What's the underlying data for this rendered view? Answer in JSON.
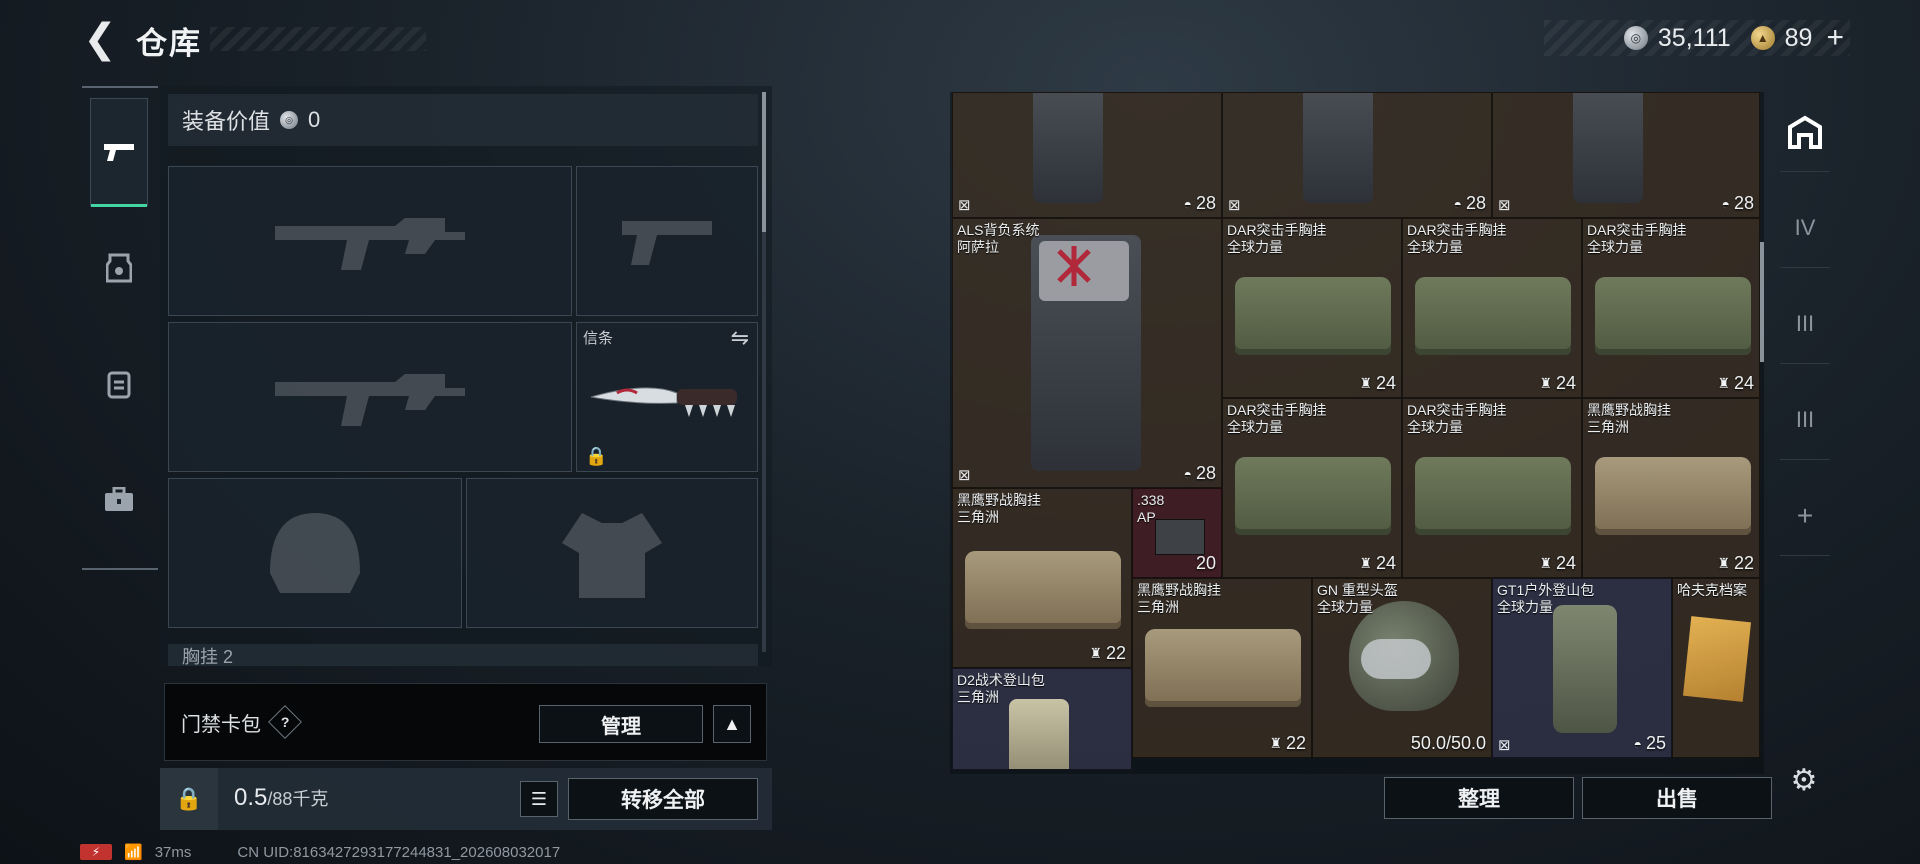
{
  "header": {
    "title": "仓库",
    "back_icon": "chevron-left-icon"
  },
  "currency": {
    "silver": "35,111",
    "gold": "89",
    "plus": "+"
  },
  "left_tabs": [
    "weapons",
    "armor",
    "backpack",
    "case"
  ],
  "loadout": {
    "equip_value_label": "装备价值",
    "equip_value": "0",
    "melee_label": "信条",
    "chest_rig_label": "胸挂",
    "chest_rig_count": "2"
  },
  "access_card": {
    "label": "门禁卡包",
    "help": "?",
    "manage": "管理",
    "collapse": "^"
  },
  "bottom": {
    "weight_current": "0.5",
    "weight_max": "/88千克",
    "transfer_all": "转移全部"
  },
  "status": {
    "battery": "⚡",
    "ping": "37ms",
    "uid": "CN UID:8163427293177244831_202608032017"
  },
  "storage": {
    "row0": [
      {
        "badge": "28"
      },
      {
        "badge": "28"
      },
      {
        "badge": "28"
      }
    ],
    "items": [
      {
        "name1": "ALS背负系统",
        "name2": "阿萨拉",
        "badge": "28"
      },
      {
        "name1": "DAR突击手胸挂",
        "name2": "全球力量",
        "badge": "24"
      },
      {
        "name1": "DAR突击手胸挂",
        "name2": "全球力量",
        "badge": "24"
      },
      {
        "name1": "DAR突击手胸挂",
        "name2": "全球力量",
        "badge": "24"
      },
      {
        "name1": "DAR突击手胸挂",
        "name2": "全球力量",
        "badge": "24"
      },
      {
        "name1": "DAR突击手胸挂",
        "name2": "全球力量",
        "badge": "24"
      },
      {
        "name1": "黑鹰野战胸挂",
        "name2": "三角洲",
        "badge": "22"
      },
      {
        "name1": "黑鹰野战胸挂",
        "name2": "三角洲",
        "badge": "22"
      },
      {
        "name1": ".338",
        "name2": "AP",
        "badge": "20"
      },
      {
        "name1": "黑鹰野战胸挂",
        "name2": "三角洲",
        "badge": "22"
      },
      {
        "name1": "GN 重型头盔",
        "name2": "全球力量",
        "badge": "50.0/50.0"
      },
      {
        "name1": "GT1户外登山包",
        "name2": "全球力量",
        "badge": "25"
      },
      {
        "name1": "哈夫克档案",
        "name2": ""
      },
      {
        "name1": "D2战术登山包",
        "name2": "三角洲"
      }
    ]
  },
  "actions": {
    "sort": "整理",
    "sell": "出售"
  },
  "right_tabs": [
    "home-icon",
    "IV",
    "III",
    "III",
    "+"
  ]
}
